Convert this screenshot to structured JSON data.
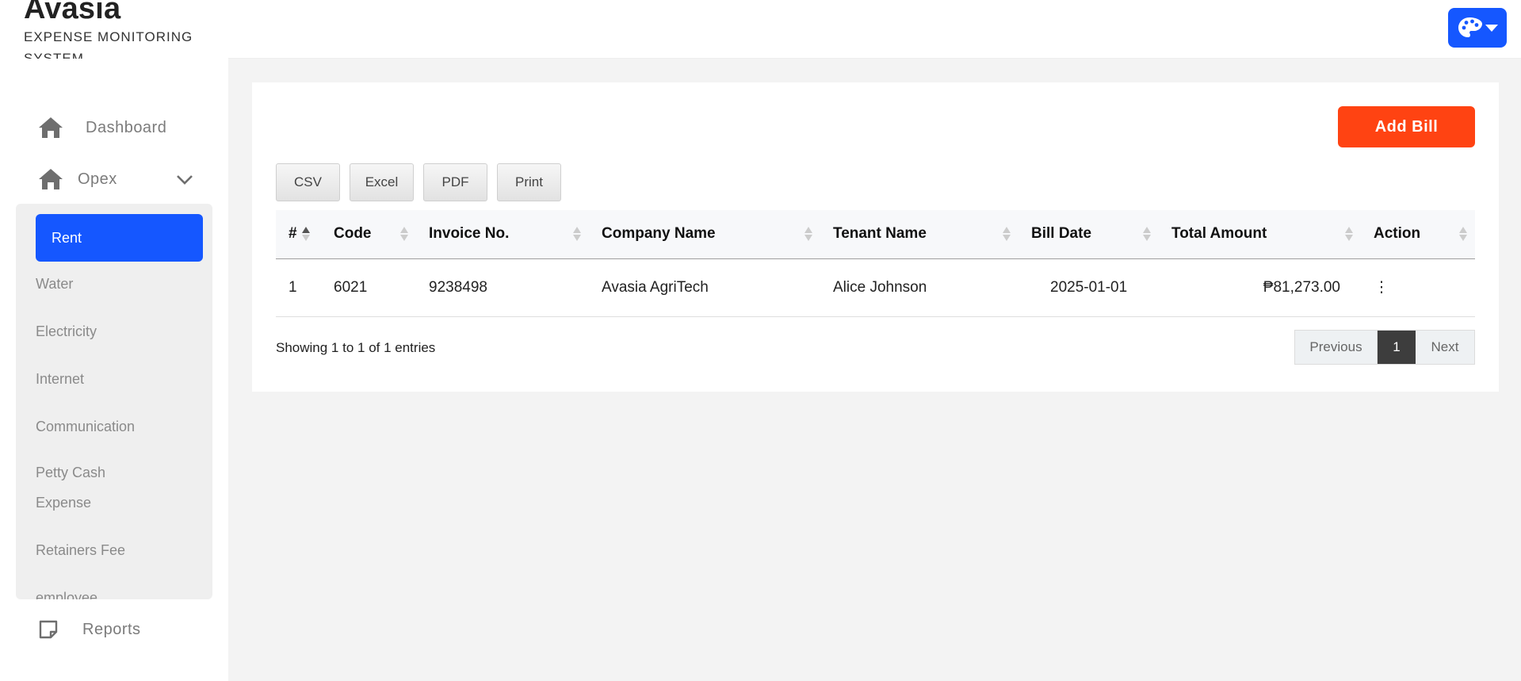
{
  "brand": {
    "title": "Avasia",
    "subtitle": "EXPENSE MONITORING SYSTEM"
  },
  "header": {
    "theme_icon": "palette-icon"
  },
  "sidebar": {
    "dashboard": "Dashboard",
    "opex": "Opex",
    "reports": "Reports",
    "submenu": [
      "Rent",
      "Water",
      "Electricity",
      "Internet",
      "Communication",
      "Petty Cash Expense",
      "Retainers Fee",
      "employee"
    ]
  },
  "actions": {
    "add_bill": "Add Bill"
  },
  "exports": [
    "CSV",
    "Excel",
    "PDF",
    "Print"
  ],
  "table": {
    "columns": [
      "#",
      "Code",
      "Invoice No.",
      "Company Name",
      "Tenant Name",
      "Bill Date",
      "Total Amount",
      "Action"
    ],
    "rows": [
      [
        "1",
        "6021",
        "9238498",
        "Avasia AgriTech",
        "Alice Johnson",
        "2025-01-01",
        "₱81,273.00",
        "⋮"
      ]
    ]
  },
  "footer": {
    "info": "Showing 1 to 1 of 1 entries",
    "previous": "Previous",
    "page": "1",
    "next": "Next"
  },
  "colors": {
    "accent": "#1557ff",
    "add_button": "#ff4312",
    "page_bg": "#f3f3f3"
  }
}
